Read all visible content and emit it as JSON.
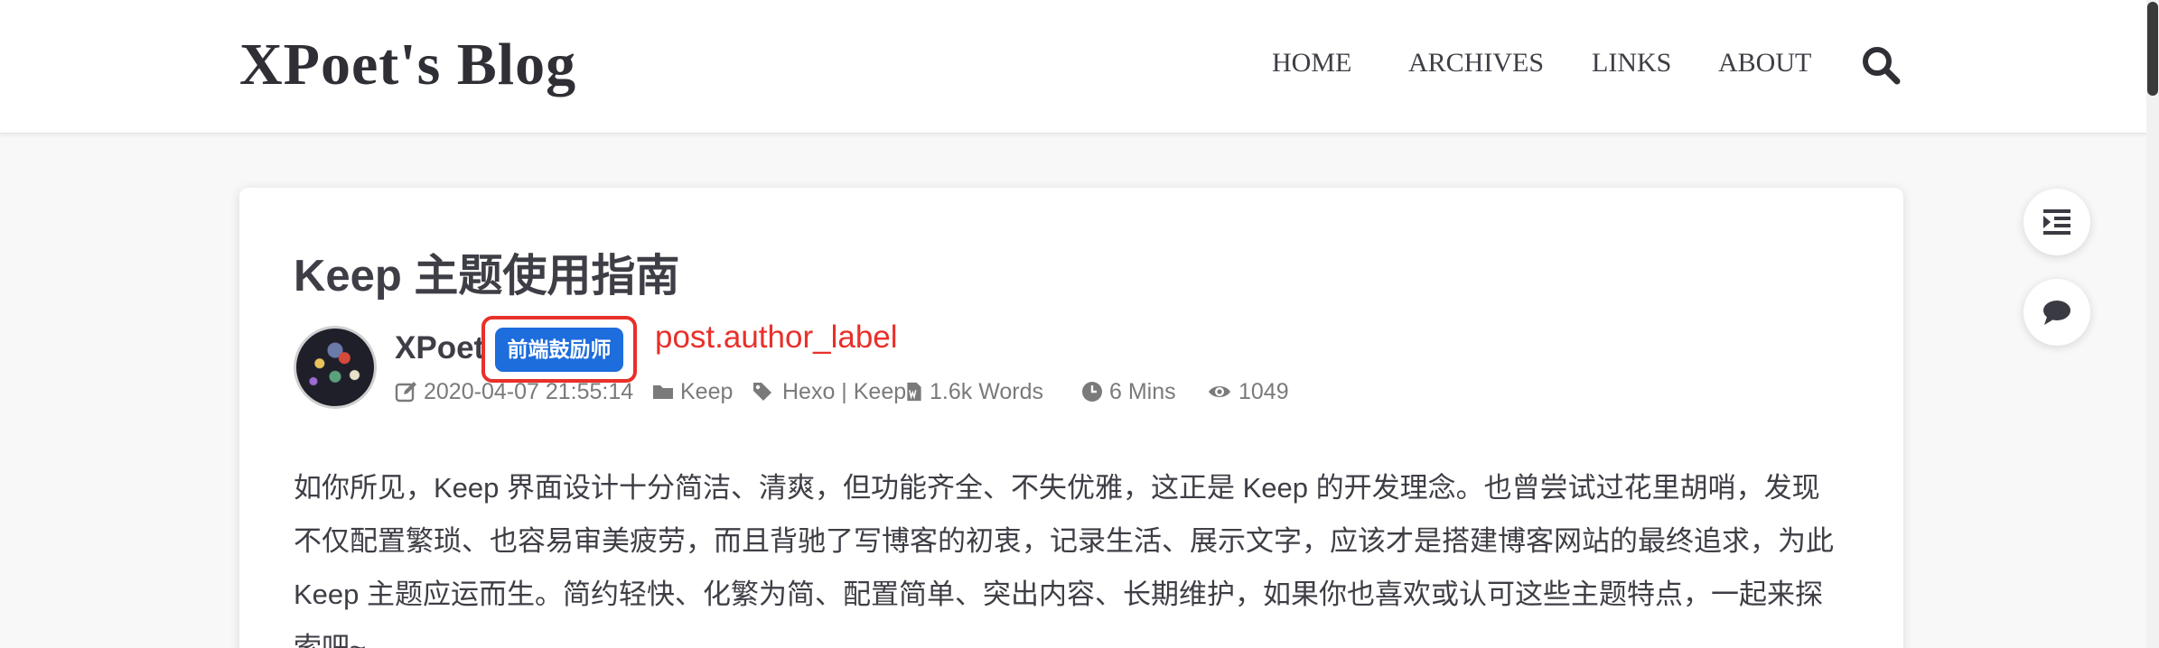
{
  "site": {
    "title": "XPoet's Blog"
  },
  "nav": {
    "items": [
      {
        "label": "HOME"
      },
      {
        "label": "ARCHIVES"
      },
      {
        "label": "LINKS"
      },
      {
        "label": "ABOUT"
      }
    ],
    "search_icon": "search-icon"
  },
  "post": {
    "title": "Keep 主题使用指南",
    "author_name": "XPoet",
    "author_label": "前端鼓励师",
    "annotation": "post.author_label",
    "meta": {
      "date": "2020-04-07 21:55:14",
      "category": "Keep",
      "tags": "Hexo | Keep",
      "words": "1.6k Words",
      "read_time": "6 Mins",
      "views": "1049"
    },
    "paragraph": "如你所见，Keep 界面设计十分简洁、清爽，但功能齐全、不失优雅，这正是 Keep 的开发理念。也曾尝试过花里胡哨，发现不仅配置繁琐、也容易审美疲劳，而且背驰了写博客的初衷，记录生活、展示文字，应该才是搭建博客网站的最终追求，为此 Keep 主题应运而生。简约轻快、化繁为简、配置简单、突出内容、长期维护，如果你也喜欢或认可这些主题特点，一起来探索吧~"
  },
  "tools": {
    "toc_icon": "toc-icon",
    "comment_icon": "comment-icon"
  },
  "colors": {
    "author_label_bg": "#1d6ddc",
    "annotation_red": "#e8302a",
    "text_dark": "#3e3e46",
    "meta_gray": "#7a7a7a"
  }
}
